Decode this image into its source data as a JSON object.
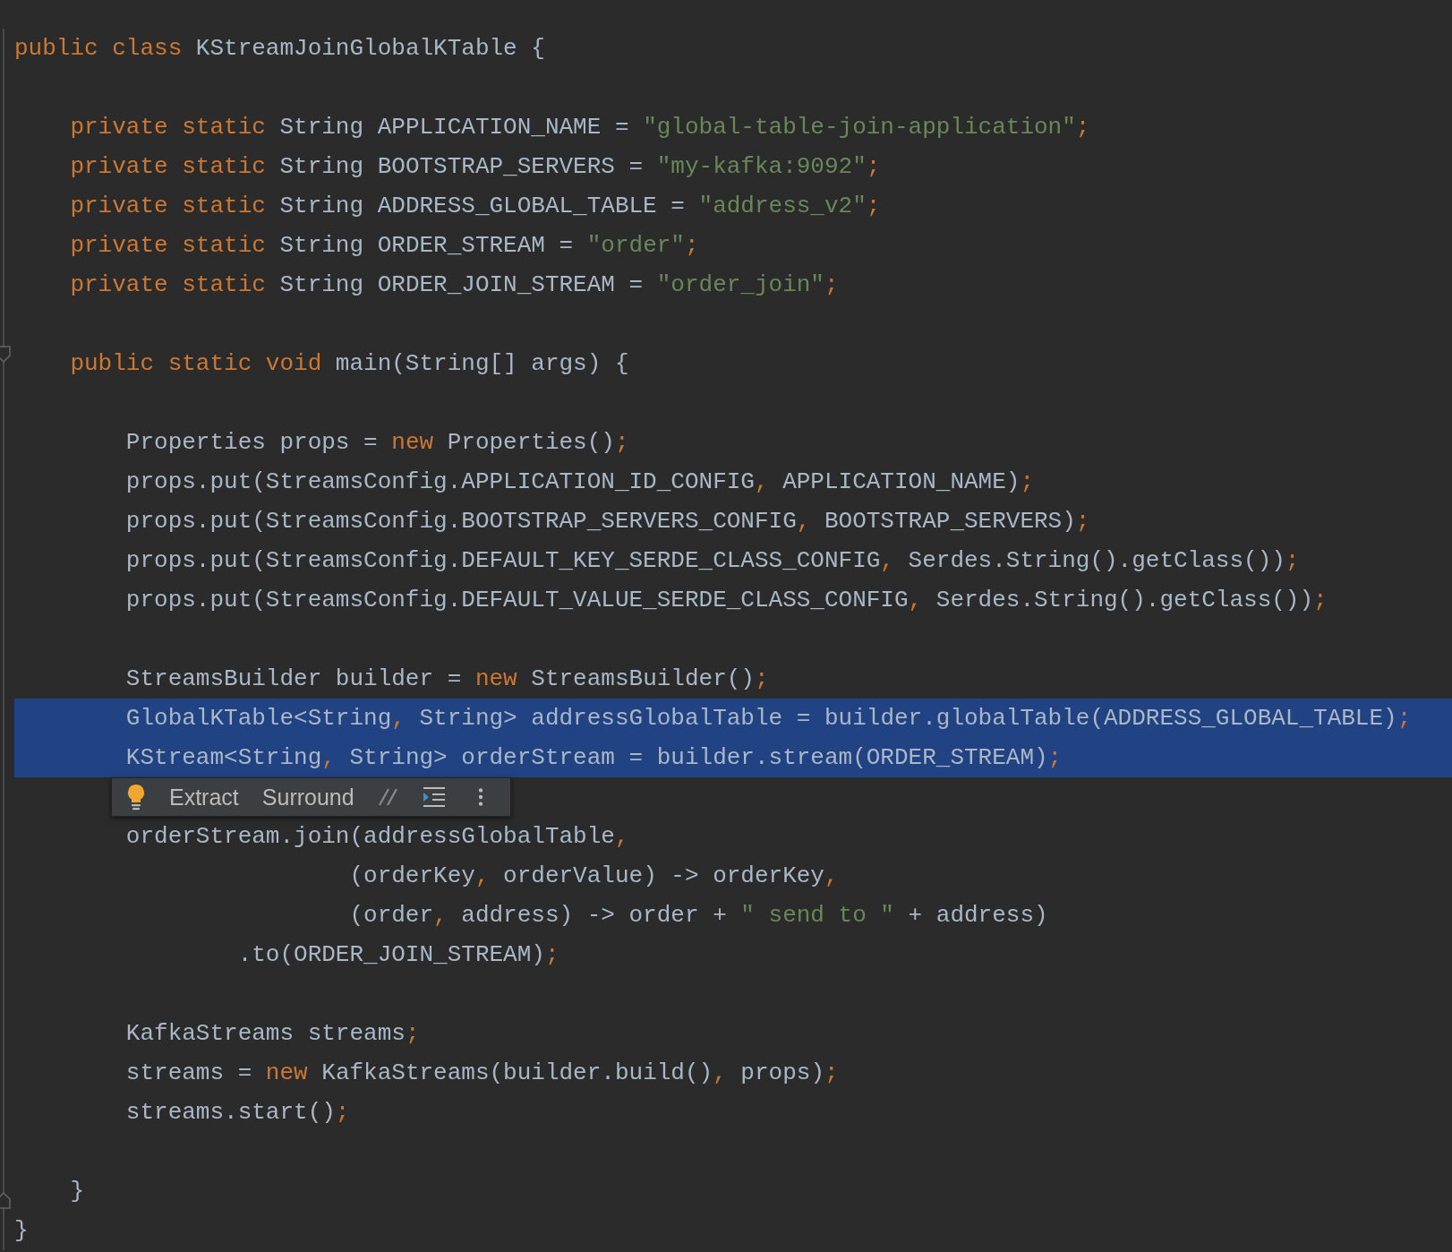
{
  "editor": {
    "lines": [
      {
        "kind": "code",
        "selected": false,
        "tokens": [
          {
            "kind": "kw",
            "t": "public class "
          },
          {
            "kind": "text",
            "t": "KStreamJoinGlobalKTable {"
          }
        ]
      },
      {
        "kind": "blank",
        "selected": false
      },
      {
        "kind": "code",
        "selected": false,
        "tokens": [
          {
            "kind": "kw",
            "t": "    private static "
          },
          {
            "kind": "text",
            "t": "String APPLICATION_NAME = "
          },
          {
            "kind": "str",
            "t": "\"global-table-join-application\""
          },
          {
            "kind": "punct",
            "t": ";"
          }
        ]
      },
      {
        "kind": "code",
        "selected": false,
        "tokens": [
          {
            "kind": "kw",
            "t": "    private static "
          },
          {
            "kind": "text",
            "t": "String BOOTSTRAP_SERVERS = "
          },
          {
            "kind": "str",
            "t": "\"my-kafka:9092\""
          },
          {
            "kind": "punct",
            "t": ";"
          }
        ]
      },
      {
        "kind": "code",
        "selected": false,
        "tokens": [
          {
            "kind": "kw",
            "t": "    private static "
          },
          {
            "kind": "text",
            "t": "String ADDRESS_GLOBAL_TABLE = "
          },
          {
            "kind": "str",
            "t": "\"address_v2\""
          },
          {
            "kind": "punct",
            "t": ";"
          }
        ]
      },
      {
        "kind": "code",
        "selected": false,
        "tokens": [
          {
            "kind": "kw",
            "t": "    private static "
          },
          {
            "kind": "text",
            "t": "String ORDER_STREAM = "
          },
          {
            "kind": "str",
            "t": "\"order\""
          },
          {
            "kind": "punct",
            "t": ";"
          }
        ]
      },
      {
        "kind": "code",
        "selected": false,
        "tokens": [
          {
            "kind": "kw",
            "t": "    private static "
          },
          {
            "kind": "text",
            "t": "String ORDER_JOIN_STREAM = "
          },
          {
            "kind": "str",
            "t": "\"order_join\""
          },
          {
            "kind": "punct",
            "t": ";"
          }
        ]
      },
      {
        "kind": "blank",
        "selected": false
      },
      {
        "kind": "code",
        "selected": false,
        "fold_start": true,
        "tokens": [
          {
            "kind": "kw",
            "t": "    public static void "
          },
          {
            "kind": "text",
            "t": "main(String[] args) {"
          }
        ]
      },
      {
        "kind": "blank",
        "selected": false
      },
      {
        "kind": "code",
        "selected": false,
        "tokens": [
          {
            "kind": "text",
            "t": "        Properties props = "
          },
          {
            "kind": "kw",
            "t": "new"
          },
          {
            "kind": "text",
            "t": " Properties()"
          },
          {
            "kind": "punct",
            "t": ";"
          }
        ]
      },
      {
        "kind": "code",
        "selected": false,
        "tokens": [
          {
            "kind": "text",
            "t": "        props.put(StreamsConfig.APPLICATION_ID_CONFIG"
          },
          {
            "kind": "punct",
            "t": ","
          },
          {
            "kind": "text",
            "t": " APPLICATION_NAME)"
          },
          {
            "kind": "punct",
            "t": ";"
          }
        ]
      },
      {
        "kind": "code",
        "selected": false,
        "tokens": [
          {
            "kind": "text",
            "t": "        props.put(StreamsConfig.BOOTSTRAP_SERVERS_CONFIG"
          },
          {
            "kind": "punct",
            "t": ","
          },
          {
            "kind": "text",
            "t": " BOOTSTRAP_SERVERS)"
          },
          {
            "kind": "punct",
            "t": ";"
          }
        ]
      },
      {
        "kind": "code",
        "selected": false,
        "tokens": [
          {
            "kind": "text",
            "t": "        props.put(StreamsConfig.DEFAULT_KEY_SERDE_CLASS_CONFIG"
          },
          {
            "kind": "punct",
            "t": ","
          },
          {
            "kind": "text",
            "t": " Serdes.String().getClass())"
          },
          {
            "kind": "punct",
            "t": ";"
          }
        ]
      },
      {
        "kind": "code",
        "selected": false,
        "tokens": [
          {
            "kind": "text",
            "t": "        props.put(StreamsConfig.DEFAULT_VALUE_SERDE_CLASS_CONFIG"
          },
          {
            "kind": "punct",
            "t": ","
          },
          {
            "kind": "text",
            "t": " Serdes.String().getClass())"
          },
          {
            "kind": "punct",
            "t": ";"
          }
        ]
      },
      {
        "kind": "blank",
        "selected": false
      },
      {
        "kind": "code",
        "selected": false,
        "tokens": [
          {
            "kind": "text",
            "t": "        StreamsBuilder builder = "
          },
          {
            "kind": "kw",
            "t": "new"
          },
          {
            "kind": "text",
            "t": " StreamsBuilder()"
          },
          {
            "kind": "punct",
            "t": ";"
          }
        ]
      },
      {
        "kind": "code",
        "selected": true,
        "tokens": [
          {
            "kind": "text",
            "t": "        GlobalKTable<String"
          },
          {
            "kind": "punct",
            "t": ","
          },
          {
            "kind": "text",
            "t": " String> addressGlobalTable = builder.globalTable(ADDRESS_GLOBAL_TABLE)"
          },
          {
            "kind": "punct",
            "t": ";"
          }
        ]
      },
      {
        "kind": "code",
        "selected": true,
        "popup": true,
        "tokens": [
          {
            "kind": "text",
            "t": "        KStream<String"
          },
          {
            "kind": "punct",
            "t": ","
          },
          {
            "kind": "text",
            "t": " String> orderStream = builder.stream(ORDER_STREAM)"
          },
          {
            "kind": "punct",
            "t": ";"
          }
        ]
      },
      {
        "kind": "blank",
        "selected": false
      },
      {
        "kind": "code",
        "selected": false,
        "tokens": [
          {
            "kind": "text",
            "t": "        orderStream.join(addressGlobalTable"
          },
          {
            "kind": "punct",
            "t": ","
          }
        ]
      },
      {
        "kind": "code",
        "selected": false,
        "tokens": [
          {
            "kind": "text",
            "t": "                        (orderKey"
          },
          {
            "kind": "punct",
            "t": ","
          },
          {
            "kind": "text",
            "t": " orderValue) -> orderKey"
          },
          {
            "kind": "punct",
            "t": ","
          }
        ]
      },
      {
        "kind": "code",
        "selected": false,
        "tokens": [
          {
            "kind": "text",
            "t": "                        (order"
          },
          {
            "kind": "punct",
            "t": ","
          },
          {
            "kind": "text",
            "t": " address) -> order + "
          },
          {
            "kind": "str",
            "t": "\" send to \""
          },
          {
            "kind": "text",
            "t": " + address)"
          }
        ]
      },
      {
        "kind": "code",
        "selected": false,
        "tokens": [
          {
            "kind": "text",
            "t": "                .to(ORDER_JOIN_STREAM)"
          },
          {
            "kind": "punct",
            "t": ";"
          }
        ]
      },
      {
        "kind": "blank",
        "selected": false
      },
      {
        "kind": "code",
        "selected": false,
        "tokens": [
          {
            "kind": "text",
            "t": "        KafkaStreams streams"
          },
          {
            "kind": "punct",
            "t": ";"
          }
        ]
      },
      {
        "kind": "code",
        "selected": false,
        "tokens": [
          {
            "kind": "text",
            "t": "        streams = "
          },
          {
            "kind": "kw",
            "t": "new"
          },
          {
            "kind": "text",
            "t": " KafkaStreams(builder.build()"
          },
          {
            "kind": "punct",
            "t": ","
          },
          {
            "kind": "text",
            "t": " props)"
          },
          {
            "kind": "punct",
            "t": ";"
          }
        ]
      },
      {
        "kind": "code",
        "selected": false,
        "tokens": [
          {
            "kind": "text",
            "t": "        streams.start()"
          },
          {
            "kind": "punct",
            "t": ";"
          }
        ]
      },
      {
        "kind": "blank",
        "selected": false
      },
      {
        "kind": "code",
        "selected": false,
        "fold_end": true,
        "tokens": [
          {
            "kind": "text",
            "t": "    }"
          }
        ]
      },
      {
        "kind": "code",
        "selected": false,
        "tokens": [
          {
            "kind": "text",
            "t": "}"
          }
        ]
      }
    ]
  },
  "popup": {
    "actions": [
      "Extract",
      "Surround"
    ]
  }
}
